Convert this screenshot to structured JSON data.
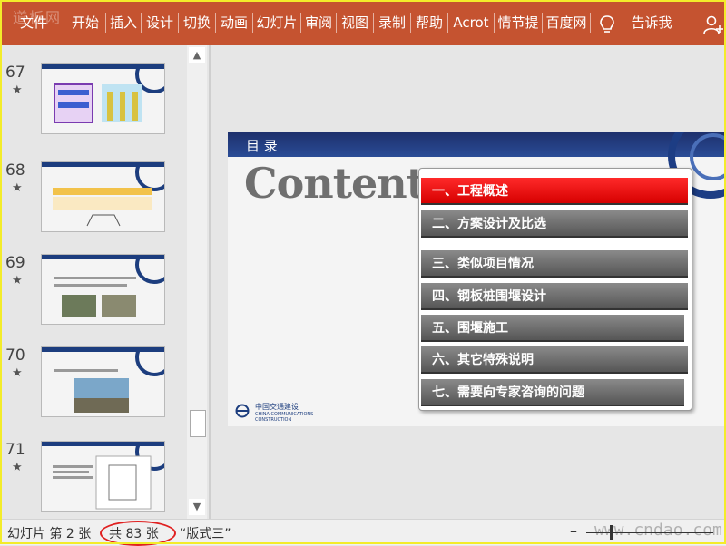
{
  "ribbon": {
    "watermark": "道板网",
    "tabs": [
      "文件",
      "开始",
      "插入",
      "设计",
      "切换",
      "动画",
      "幻灯片",
      "审阅",
      "视图",
      "录制",
      "帮助",
      "Acrot",
      "情节提",
      "百度网"
    ],
    "tell_me": "告诉我",
    "colors": {
      "ribbon_bg": "#c55330",
      "frame": "#f3ec2a"
    }
  },
  "thumbnails": [
    {
      "number": "67",
      "star": "★"
    },
    {
      "number": "68",
      "star": "★"
    },
    {
      "number": "69",
      "star": "★"
    },
    {
      "number": "70",
      "star": "★"
    },
    {
      "number": "71",
      "star": "★"
    }
  ],
  "scrollbar": {
    "up": "▲",
    "down": "▼"
  },
  "slide": {
    "header_title": "目 录",
    "contents_title": "Contents",
    "menu": [
      "一、工程概述",
      "二、方案设计及比选",
      "三、类似项目情况",
      "四、钢板桩围堰设计",
      "五、围堰施工",
      "六、其它特殊说明",
      "七、需要向专家咨询的问题"
    ],
    "active_index": 0,
    "logo_cn": "中国交通建设",
    "logo_en": "CHINA COMMUNICATIONS CONSTRUCTION"
  },
  "status": {
    "slide_of": "幻灯片 第 2 张",
    "total": "共 83 张",
    "layout": "“版式三”",
    "zoom_minus": "–",
    "site_watermark": "www.cndao.com"
  }
}
